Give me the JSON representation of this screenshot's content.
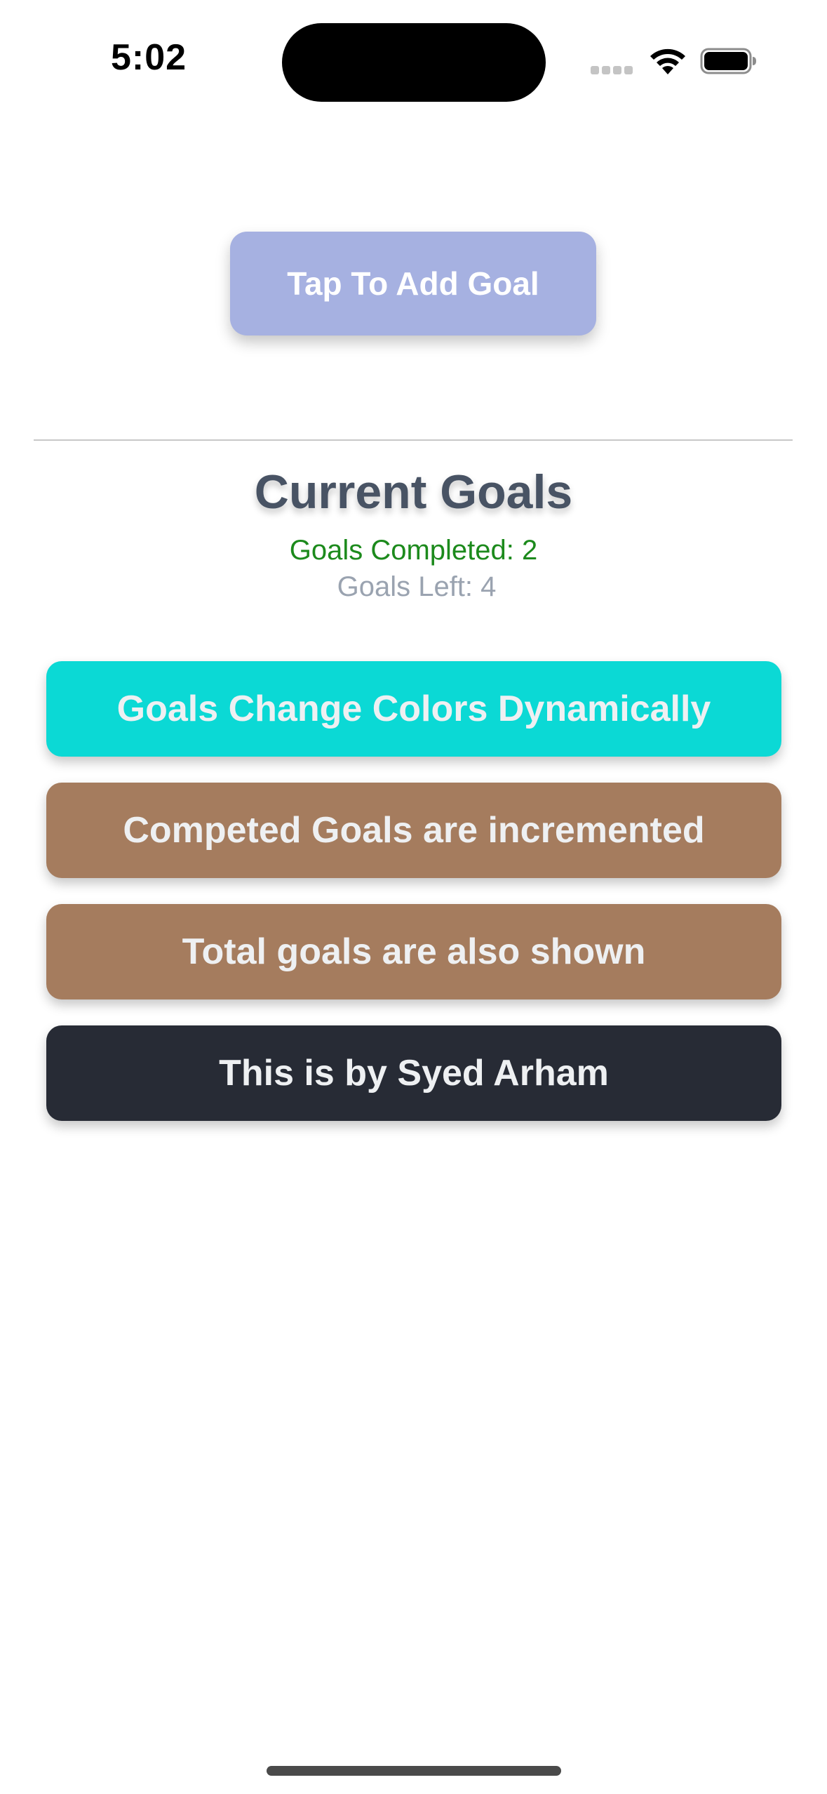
{
  "status_bar": {
    "time": "5:02",
    "wifi_icon": "wifi-icon",
    "battery_icon": "battery-icon"
  },
  "add_goal_button": {
    "label": "Tap To Add Goal",
    "color": "#a6b1e1"
  },
  "goals_section": {
    "title": "Current Goals",
    "completed_text": "Goals Completed: 2",
    "left_text": "Goals Left: 4",
    "completed_color": "#1c8a1c",
    "left_color": "#9aa3b0"
  },
  "goals": [
    {
      "label": "Goals Change Colors Dynamically",
      "color": "#0bd9d5"
    },
    {
      "label": "Competed Goals are incremented",
      "color": "#a57c5e"
    },
    {
      "label": "Total goals are also shown",
      "color": "#a57c5e"
    },
    {
      "label": "This is by Syed Arham",
      "color": "#272b35"
    }
  ]
}
